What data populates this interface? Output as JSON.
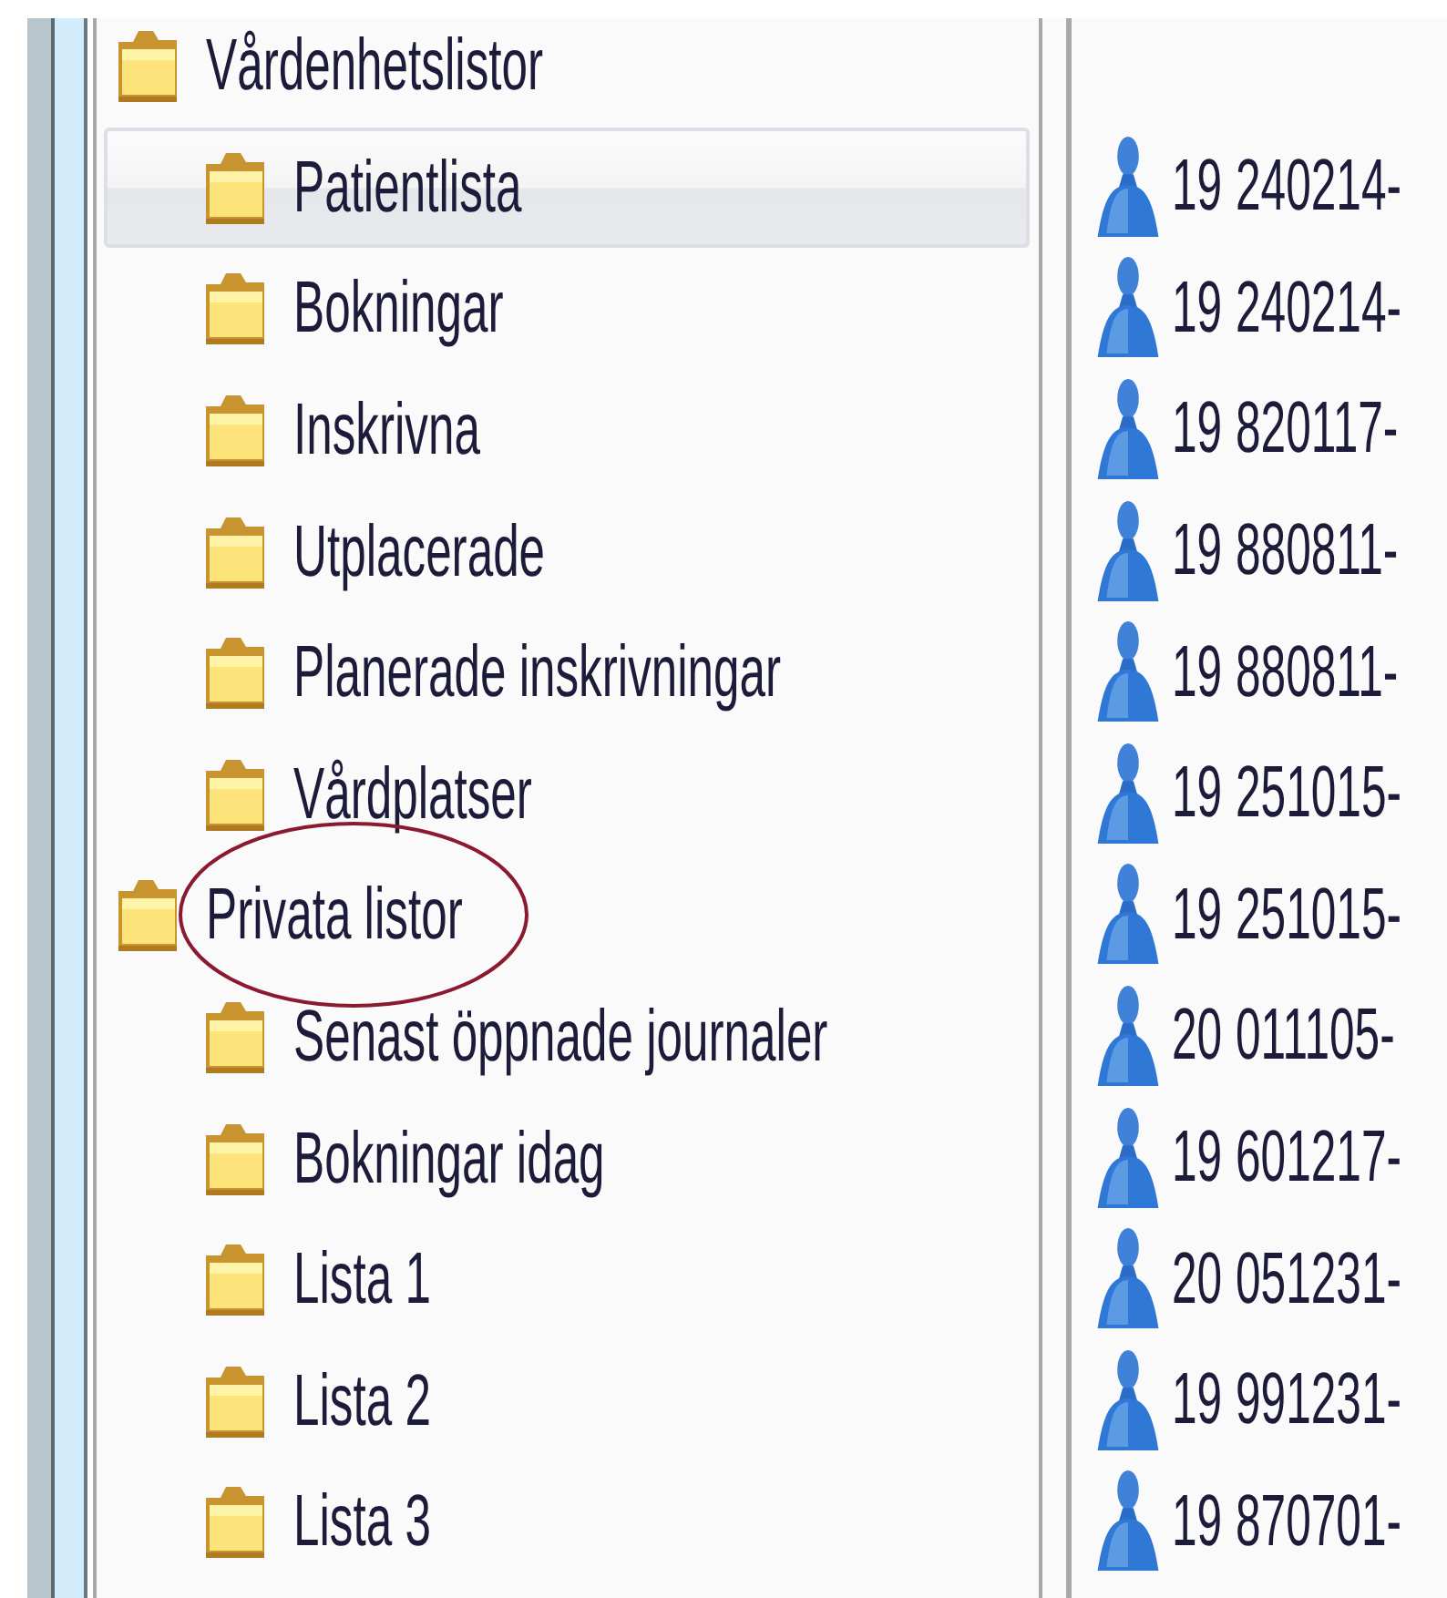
{
  "tree": [
    {
      "label": "Vårdenhetslistor",
      "selected": false,
      "circled": false,
      "children": [
        {
          "label": "Patientlista",
          "selected": true,
          "circled": false
        },
        {
          "label": "Bokningar",
          "selected": false,
          "circled": false
        },
        {
          "label": "Inskrivna",
          "selected": false,
          "circled": false
        },
        {
          "label": "Utplacerade",
          "selected": false,
          "circled": false
        },
        {
          "label": "Planerade inskrivningar",
          "selected": false,
          "circled": false
        },
        {
          "label": "Vårdplatser",
          "selected": false,
          "circled": false
        }
      ]
    },
    {
      "label": "Privata listor",
      "selected": false,
      "circled": true,
      "children": [
        {
          "label": "Senast öppnade journaler",
          "selected": false,
          "circled": false
        },
        {
          "label": "Bokningar idag",
          "selected": false,
          "circled": false
        },
        {
          "label": "Lista 1",
          "selected": false,
          "circled": false
        },
        {
          "label": "Lista 2",
          "selected": false,
          "circled": false
        },
        {
          "label": "Lista 3",
          "selected": false,
          "circled": false
        }
      ]
    }
  ],
  "patients": [
    {
      "century": "19",
      "number": "240214-"
    },
    {
      "century": "19",
      "number": "240214-"
    },
    {
      "century": "19",
      "number": "820117-"
    },
    {
      "century": "19",
      "number": "880811-"
    },
    {
      "century": "19",
      "number": "880811-"
    },
    {
      "century": "19",
      "number": "251015-"
    },
    {
      "century": "19",
      "number": "251015-"
    },
    {
      "century": "20",
      "number": "011105-"
    },
    {
      "century": "19",
      "number": "601217-"
    },
    {
      "century": "20",
      "number": "051231-"
    },
    {
      "century": "19",
      "number": "991231-"
    },
    {
      "century": "19",
      "number": "870701-"
    }
  ]
}
